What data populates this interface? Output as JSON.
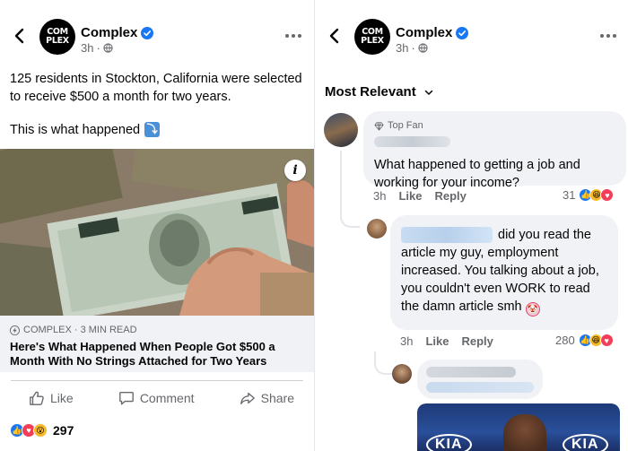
{
  "left": {
    "page_name": "Complex",
    "logo_line1": "COM",
    "logo_line2": "PLEX",
    "time": "3h",
    "post_text": "125 residents in Stockton, California were selected to receive $500 a month for two years.",
    "post_text_2": "This is what happened",
    "arrow_emoji": "⤵",
    "info_label": "i",
    "link": {
      "source": "COMPLEX · 3 MIN READ",
      "title": "Here's What Happened When People Got $500 a Month With No Strings Attached for Two Years"
    },
    "actions": {
      "like": "Like",
      "comment": "Comment",
      "share": "Share"
    },
    "reaction_count": "297"
  },
  "right": {
    "page_name": "Complex",
    "logo_line1": "COM",
    "logo_line2": "PLEX",
    "time": "3h",
    "sort_label": "Most Relevant",
    "comments": [
      {
        "badge": "Top Fan",
        "text": "What happened to getting a job and working for your income?",
        "time": "3h",
        "like": "Like",
        "reply": "Reply",
        "reactions": "31"
      },
      {
        "text_first": "did you read the",
        "text_rest": "article my guy, employment increased. You talking about a job, you couldn't even WORK to read the damn article smh",
        "time": "3h",
        "like": "Like",
        "reply": "Reply",
        "reactions": "280"
      }
    ],
    "photo_text": "KIA"
  },
  "colors": {
    "facebook_blue": "#1877f2",
    "love_red": "#f33e58",
    "secondary_text": "#65676b",
    "bubble_gray": "#f0f2f5"
  }
}
